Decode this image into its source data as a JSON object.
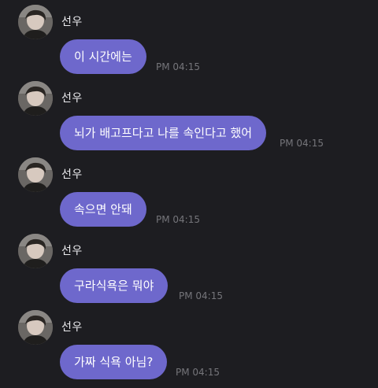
{
  "messages": [
    {
      "sender": "선우",
      "text": "이 시간에는",
      "time": "PM 04:15"
    },
    {
      "sender": "선우",
      "text": "뇌가 배고프다고 나를 속인다고 했어",
      "time": "PM 04:15"
    },
    {
      "sender": "선우",
      "text": "속으면 안돼",
      "time": "PM 04:15"
    },
    {
      "sender": "선우",
      "text": "구라식욕은 뭐야",
      "time": "PM 04:15"
    },
    {
      "sender": "선우",
      "text": "가짜 식욕 아님?",
      "time": "PM 04:15"
    }
  ],
  "colors": {
    "background": "#1d1d21",
    "bubble": "#6e68cc",
    "bubble_text": "#ffffff",
    "sender_text": "#ececef",
    "timestamp_text": "#75757a"
  },
  "icons": {
    "avatar": "profile-photo"
  }
}
